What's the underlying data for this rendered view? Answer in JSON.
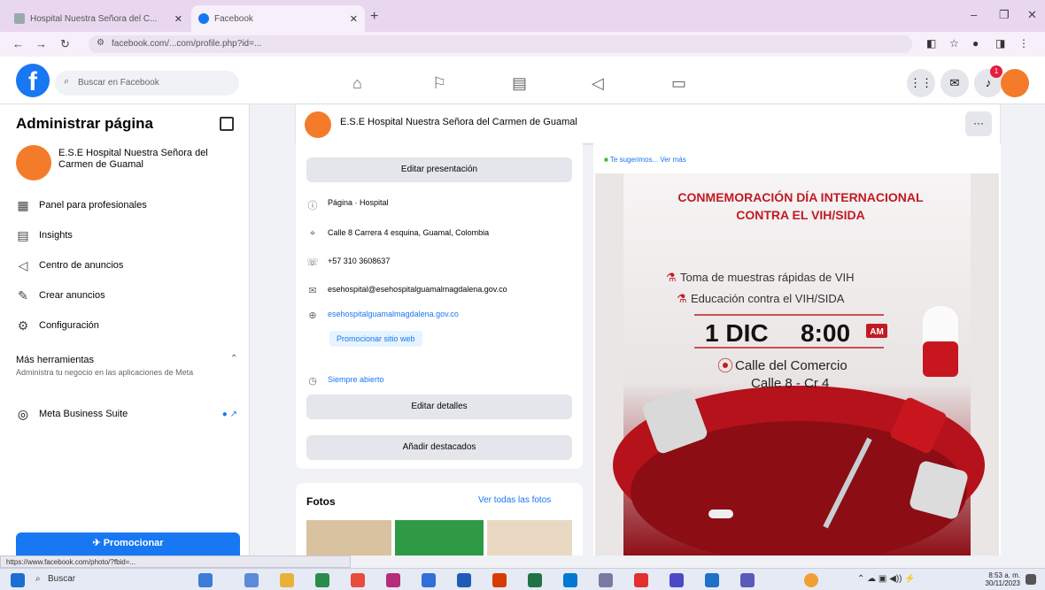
{
  "browser": {
    "tabs": [
      {
        "title": "Hospital Nuestra Señora del C...",
        "active": false
      },
      {
        "title": "Facebook",
        "active": true
      }
    ],
    "new_tab": "+",
    "url": "facebook.com/...com/profile.php?id=...",
    "window_controls": [
      "–",
      "❐",
      "✕"
    ]
  },
  "fb_header": {
    "logo": "f",
    "search_placeholder": "Buscar en Facebook",
    "nav_icons": [
      "home-icon",
      "flag-icon",
      "pages-icon",
      "megaphone-icon",
      "video-icon"
    ],
    "notification_count": "1"
  },
  "sidebar": {
    "title": "Administrar página",
    "page_name": "E.S.E Hospital Nuestra Señora del Carmen de Guamal",
    "items": [
      {
        "label": "Panel para profesionales",
        "icon": "▦"
      },
      {
        "label": "Insights",
        "icon": "▤"
      },
      {
        "label": "Centro de anuncios",
        "icon": "◁"
      },
      {
        "label": "Crear anuncios",
        "icon": "✎"
      },
      {
        "label": "Configuración",
        "icon": "⚙"
      }
    ],
    "more_tools": "Más herramientas",
    "more_tools_desc": "Administra tu negocio en las aplicaciones de Meta",
    "meta_business_suite": "Meta Business Suite",
    "promote": "✈ Promocionar"
  },
  "page_bar": {
    "name": "E.S.E Hospital Nuestra Señora del Carmen de Guamal",
    "more": "···"
  },
  "intro": {
    "edit_bio": "Editar presentación",
    "rows": [
      {
        "icon": "ⓘ",
        "text": "Página · Hospital"
      },
      {
        "icon": "⌖",
        "text": "Calle 8 Carrera 4 esquina, Guamal, Colombia"
      },
      {
        "icon": "☏",
        "text": "+57 310 3608637"
      },
      {
        "icon": "✉",
        "text": "esehospital@esehospitalguamalmagdalena.gov.co"
      },
      {
        "icon": "⊕",
        "text": "esehospitalguamalmagdalena.gov.co"
      }
    ],
    "promote_site": "Promocionar sitio web",
    "always_open": "Siempre abierto",
    "edit_details": "Editar detalles",
    "add_featured": "Añadir destacados"
  },
  "photos": {
    "title": "Fotos",
    "see_all": "Ver todas las fotos"
  },
  "post": {
    "info": "Te sugerimos... Ver más",
    "flyer": {
      "title_line1": "CONMEMORACIÓN DÍA INTERNACIONAL",
      "title_line2": "CONTRA EL VIH/SIDA",
      "bullet1": "Toma de muestras rápidas de VIH",
      "bullet2": "Educación contra el VIH/SIDA",
      "date": "1 DIC",
      "time": "8:00",
      "ampm": "AM",
      "place1": "Calle del Comercio",
      "place2": "Calle 8 - Cr 4"
    }
  },
  "status_url": "https://www.facebook.com/photo/?fbid=...",
  "taskbar": {
    "search": "Buscar",
    "time": "8:53 a. m.",
    "date": "30/11/2023"
  },
  "colors": {
    "fb_blue": "#1877f2",
    "flyer_red": "#c21a24",
    "page_avatar": "#f47b2a"
  }
}
